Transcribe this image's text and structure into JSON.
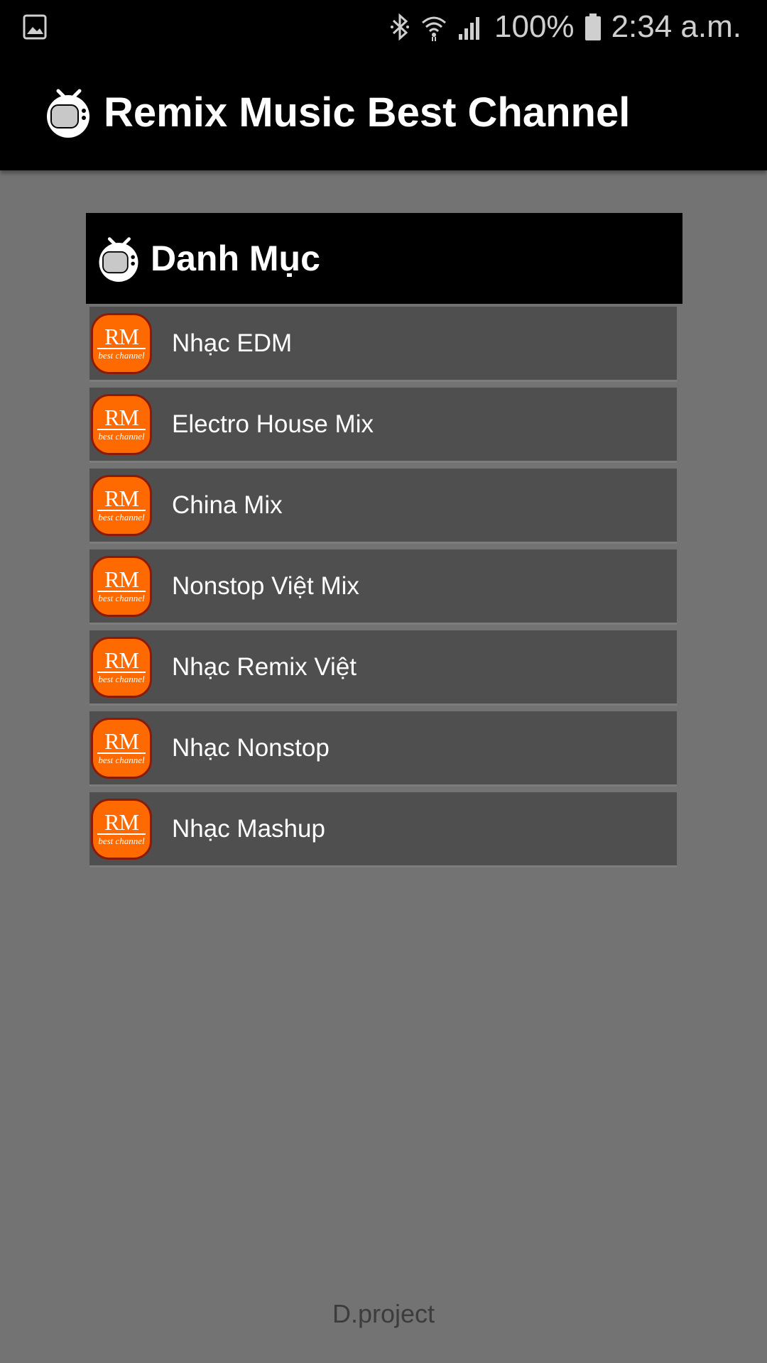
{
  "status_bar": {
    "battery": "100%",
    "time": "2:34 a.m.",
    "icons": [
      "gallery-icon",
      "bluetooth-icon",
      "wifi-icon",
      "signal-icon",
      "battery-icon"
    ]
  },
  "app_bar": {
    "title": "Remix Music Best Channel",
    "icon": "tv-icon"
  },
  "category": {
    "title": "Danh Mục",
    "icon": "tv-icon",
    "logo_text": "RM",
    "logo_subtext": "best channel",
    "items": [
      {
        "label": "Nhạc EDM"
      },
      {
        "label": "Electro House Mix"
      },
      {
        "label": "China Mix"
      },
      {
        "label": "Nonstop Việt Mix"
      },
      {
        "label": "Nhạc Remix Việt"
      },
      {
        "label": "Nhạc Nonstop"
      },
      {
        "label": "Nhạc Mashup"
      }
    ]
  },
  "footer": {
    "text": "D.project"
  },
  "colors": {
    "background": "#737373",
    "bar": "#000000",
    "list_item": "#4f4f4f",
    "logo_orange": "#ff6a00"
  }
}
